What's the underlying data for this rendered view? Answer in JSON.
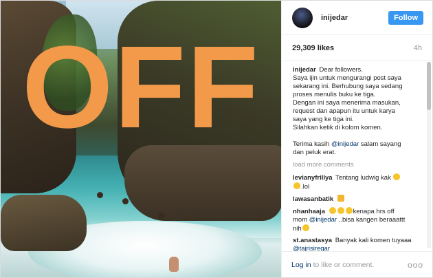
{
  "post": {
    "overlay_text": "OFF"
  },
  "header": {
    "username": "inijedar",
    "follow_label": "Follow"
  },
  "stats": {
    "likes": "29,309 likes",
    "time": "4h"
  },
  "caption": {
    "username": "inijedar",
    "lines": [
      "Dear followers.",
      "Saya ijin untuk mengurangi post saya",
      "sekarang ini. Berhubung saya sedang",
      "proses menulis buku ke tiga.",
      "Dengan ini saya menerima masukan,",
      "request dan apapun itu untuk karya",
      "saya yang ke tiga ini.",
      "Silahkan ketik di kolom komen."
    ],
    "thanks_before": "Terima kasih ",
    "thanks_mention": "@inijedar",
    "thanks_after": " salam sayang",
    "thanks_line2": "dan peluk erat."
  },
  "load_more": "load more comments",
  "comments": [
    {
      "username": "levianyfrillya",
      "text": "Tentang ludwig kak",
      "text2": ".lol"
    },
    {
      "username": "lawasanbatik",
      "text": ""
    },
    {
      "username": "nhanhaaja",
      "text": "kenapa hrs off",
      "text2": "mom",
      "mention": "@inijedar",
      "text3": "..bisa kangen beraaattt",
      "text4": "nih"
    },
    {
      "username": "st.anastasya",
      "text": "Banyak kali komen tuyaaa",
      "mention": "@tajrisiregar"
    }
  ],
  "footer": {
    "login": "Log in",
    "rest": "to like or comment.",
    "more": "ooo"
  },
  "icons": {
    "emoji": "emoji-icon",
    "thumbs": "thumbs-up-icon",
    "more": "more-options-icon"
  },
  "colors": {
    "accent": "#3897f0",
    "overlay": "#f29a4a",
    "link": "#003569"
  }
}
